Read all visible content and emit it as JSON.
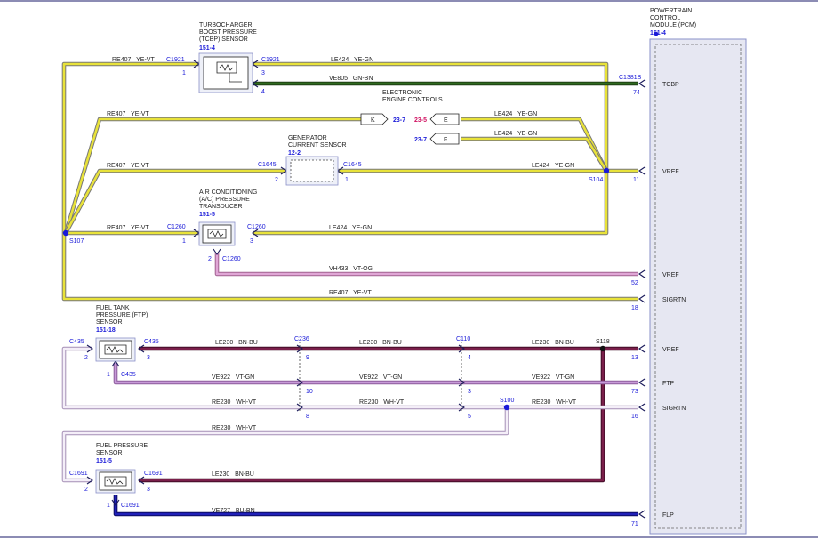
{
  "pcm": {
    "title": [
      "POWERTRAIN",
      "CONTROL",
      "MODULE (PCM)"
    ],
    "ref": "151-4"
  },
  "pcm_pins": [
    {
      "num": "74",
      "name": "TCBP"
    },
    {
      "num": "11",
      "name": "VREF"
    },
    {
      "num": "52",
      "name": "VREF"
    },
    {
      "num": "18",
      "name": "SIGRTN"
    },
    {
      "num": "13",
      "name": "VREF"
    },
    {
      "num": "73",
      "name": "FTP"
    },
    {
      "num": "16",
      "name": "SIGRTN"
    },
    {
      "num": "71",
      "name": "FLP"
    }
  ],
  "components": {
    "tcbp": {
      "title": [
        "TURBOCHARGER",
        "BOOST PRESSURE",
        "(TCBP) SENSOR"
      ],
      "ref": "151-4"
    },
    "gen": {
      "title": [
        "GENERATOR",
        "CURRENT SENSOR"
      ],
      "ref": "12-2"
    },
    "ac": {
      "title": [
        "AIR CONDITIONING",
        "(A/C) PRESSURE",
        "TRANSDUCER"
      ],
      "ref": "151-5"
    },
    "ftp": {
      "title": [
        "FUEL TANK",
        "PRESSURE (FTP)",
        "SENSOR"
      ],
      "ref": "151-18"
    },
    "fps": {
      "title": [
        "FUEL PRESSURE",
        "SENSOR"
      ],
      "ref": "151-5"
    },
    "eec": {
      "title": [
        "ELECTRONIC",
        "ENGINE CONTROLS"
      ]
    }
  },
  "refs": {
    "k_ref": "23-7",
    "e_ref": "23-5",
    "f_ref": "23-7",
    "k_letter": "K",
    "e_letter": "E",
    "f_letter": "F"
  },
  "connectors": {
    "c1921a": "C1921",
    "c1921b": "C1921",
    "c1381b": "C1381B",
    "c1645a": "C1645",
    "c1645b": "C1645",
    "c1260a": "C1260",
    "c1260b": "C1260",
    "c1260c": "C1260",
    "c435a": "C435",
    "c435b": "C435",
    "c435c": "C435",
    "c236": "C236",
    "c110": "C110",
    "c1691a": "C1691",
    "c1691b": "C1691",
    "c1691c": "C1691"
  },
  "splices": {
    "s107": "S107",
    "s104": "S104",
    "s118": "S118",
    "s100": "S100"
  },
  "pins": {
    "tcbp_1": "1",
    "tcbp_3": "3",
    "tcbp_4": "4",
    "gen_2": "2",
    "gen_1": "1",
    "ac_1": "1",
    "ac_3": "3",
    "ac_2": "2",
    "ftp_2": "2",
    "ftp_3": "3",
    "ftp_1": "1",
    "c236_9": "9",
    "c236_10": "10",
    "c236_8": "8",
    "c110_4": "4",
    "c110_3": "3",
    "c110_5": "5",
    "fps_2": "2",
    "fps_3": "3",
    "fps_1": "1"
  },
  "wires": {
    "re407_a": "RE407   YE-VT",
    "re407_b": "RE407   YE-VT",
    "re407_c": "RE407   YE-VT",
    "re407_d": "RE407   YE-VT",
    "re407_e": "RE407   YE-VT",
    "le424_a": "LE424   YE-GN",
    "le424_b": "LE424   YE-GN",
    "le424_c": "LE424   YE-GN",
    "le424_d": "LE424   YE-GN",
    "le424_e": "LE424   YE-GN",
    "ve805": "VE805   GN-BN",
    "vh433": "VH433   VT-OG",
    "le230_a": "LE230   BN-BU",
    "le230_b": "LE230   BN-BU",
    "le230_c": "LE230   BN-BU",
    "le230_d": "LE230   BN-BU",
    "ve922_a": "VE922   VT-GN",
    "ve922_b": "VE922   VT-GN",
    "ve922_c": "VE922   VT-GN",
    "re230_a": "RE230   WH-VT",
    "re230_b": "RE230   WH-VT",
    "re230_c": "RE230   WH-VT",
    "re230_d": "RE230   WH-VT",
    "ve727": "VE727   BU-BN"
  },
  "colors": {
    "yellow": "#e8e23a",
    "green": "#2f6a1f",
    "pink": "#d98ccc",
    "maroon": "#7a1f4a",
    "violet_green": "#c79ad8",
    "white_violet": "#f4eef8",
    "blue": "#1a1ab8"
  }
}
